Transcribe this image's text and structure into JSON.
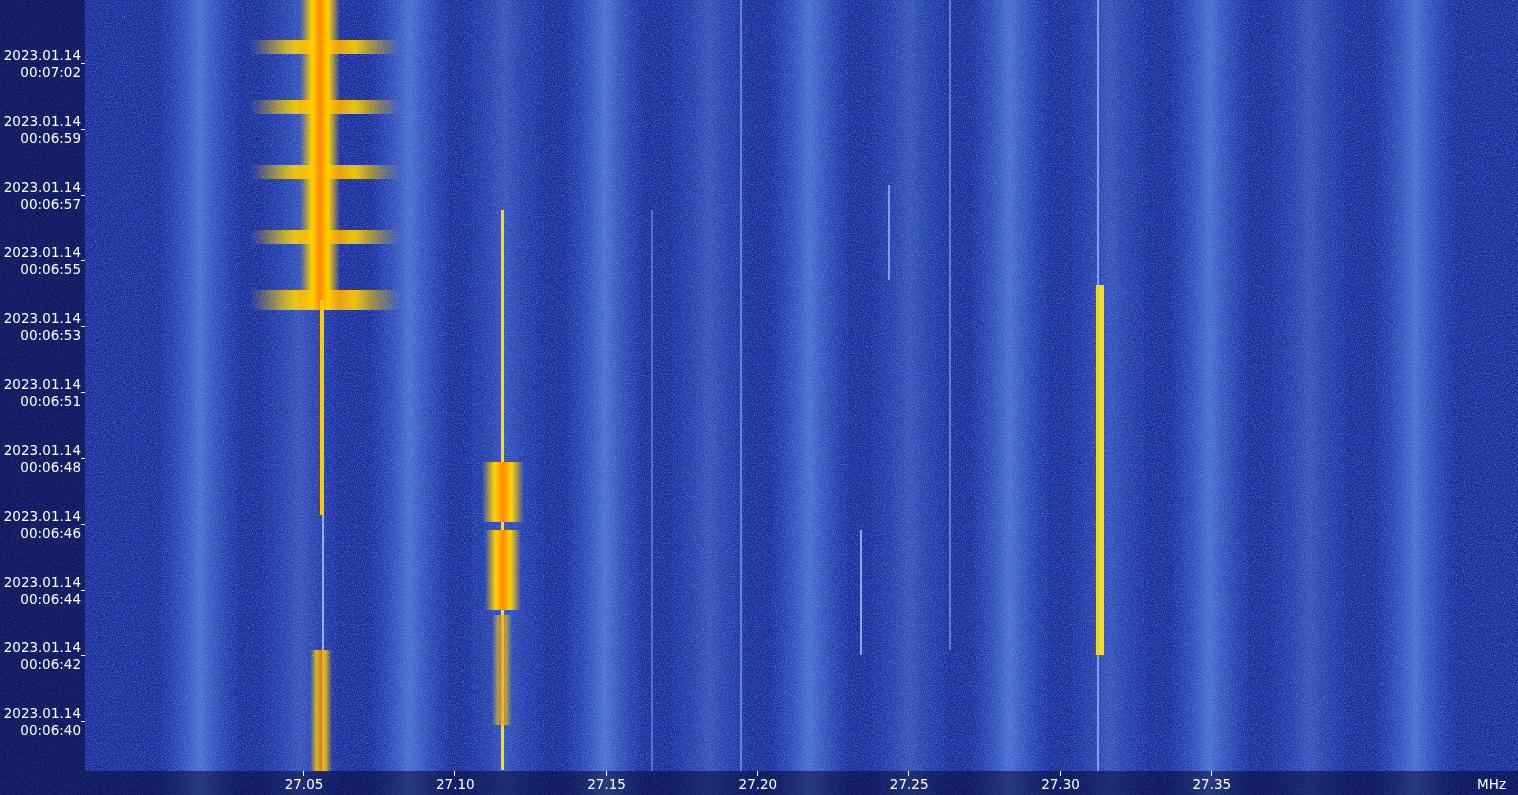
{
  "time_axis": {
    "labels": [
      {
        "date": "2023.01.14",
        "time": "00:07:02"
      },
      {
        "date": "2023.01.14",
        "time": "00:06:59"
      },
      {
        "date": "2023.01.14",
        "time": "00:06:57"
      },
      {
        "date": "2023.01.14",
        "time": "00:06:55"
      },
      {
        "date": "2023.01.14",
        "time": "00:06:53"
      },
      {
        "date": "2023.01.14",
        "time": "00:06:51"
      },
      {
        "date": "2023.01.14",
        "time": "00:06:48"
      },
      {
        "date": "2023.01.14",
        "time": "00:06:46"
      },
      {
        "date": "2023.01.14",
        "time": "00:06:44"
      },
      {
        "date": "2023.01.14",
        "time": "00:06:42"
      },
      {
        "date": "2023.01.14",
        "time": "00:06:40"
      }
    ]
  },
  "frequency_axis": {
    "labels": [
      "27.05",
      "27.10",
      "27.15",
      "27.20",
      "27.25",
      "27.30",
      "27.35"
    ],
    "unit": "MHz"
  }
}
